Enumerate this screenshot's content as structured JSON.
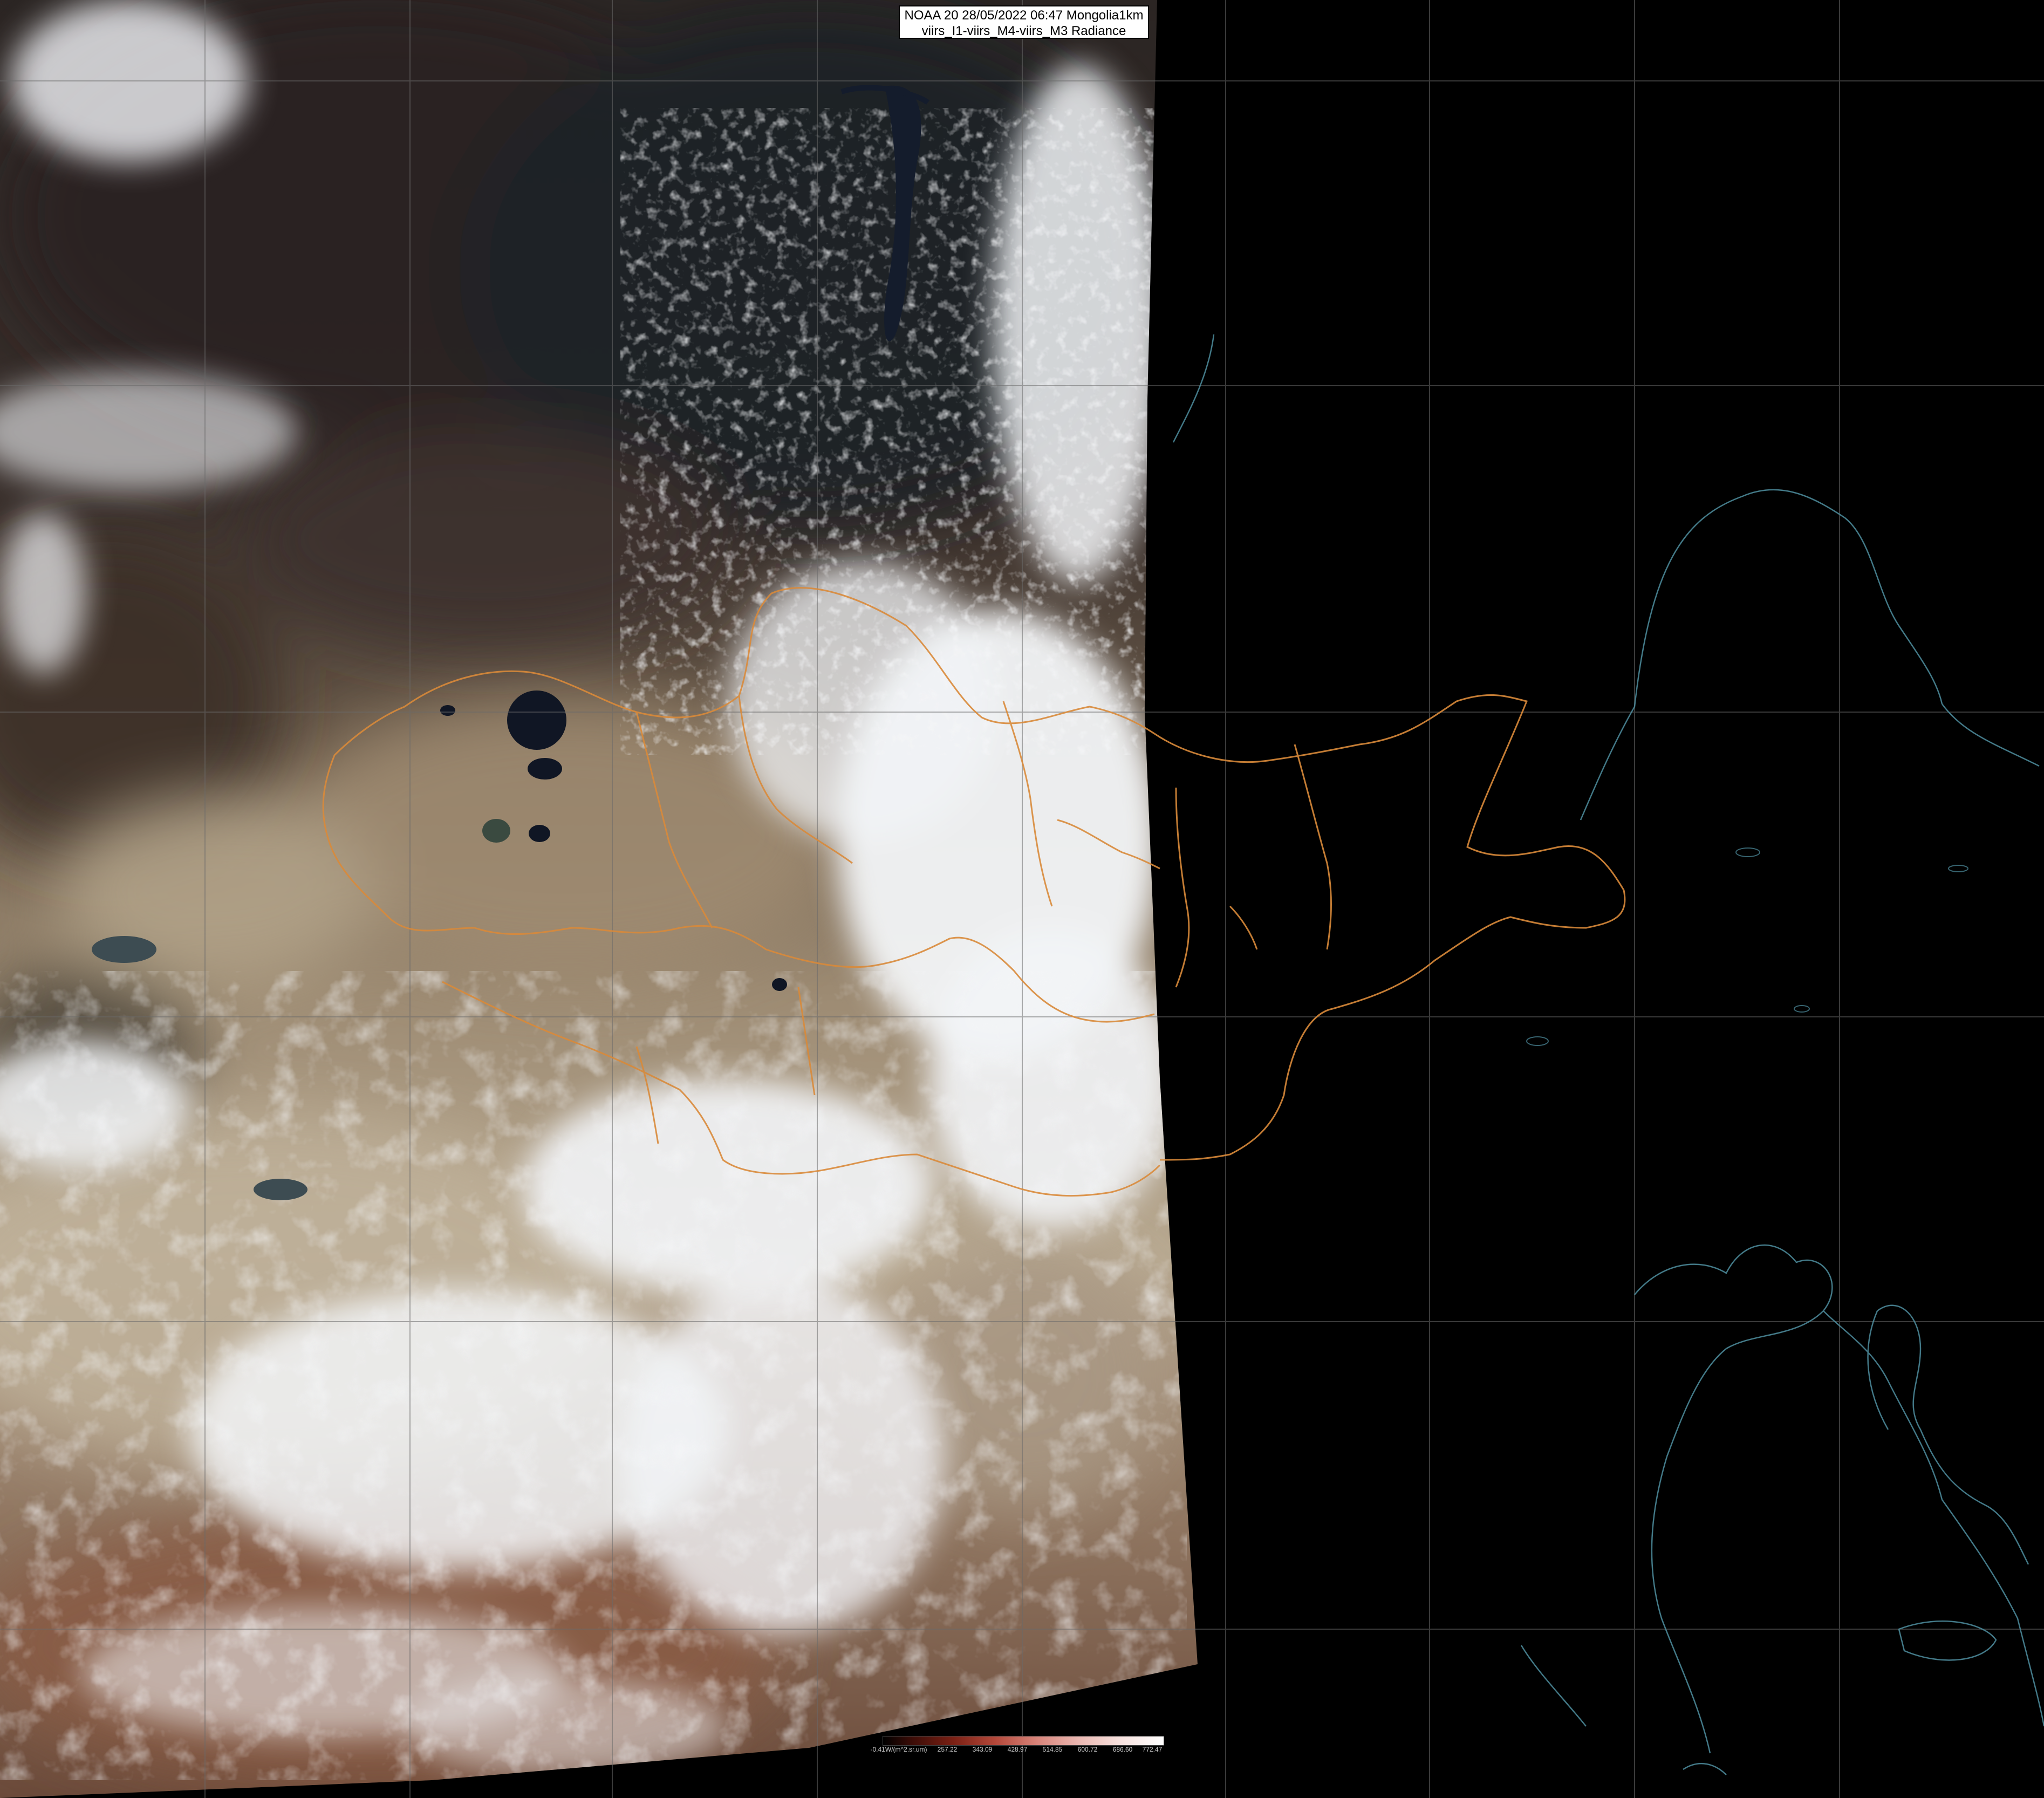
{
  "title": {
    "line1": "NOAA 20 28/05/2022 06:47 Mongolia1km",
    "line2": "viirs_I1-viirs_M4-viirs_M3 Radiance"
  },
  "legend": {
    "unit_label": "-0.41W/(m^2.sr.um)",
    "ticks": [
      "257.22",
      "343.09",
      "428.97",
      "514.85",
      "600.72",
      "686.60",
      "772.47"
    ]
  },
  "colors": {
    "border_orange": "#d98a3a",
    "coastline_cyan": "#4f8fa0",
    "grid": "#6a6a6a",
    "cloud": "#f2f4f7",
    "desert": "#b7a58d",
    "forest": "#3a2f2a"
  }
}
